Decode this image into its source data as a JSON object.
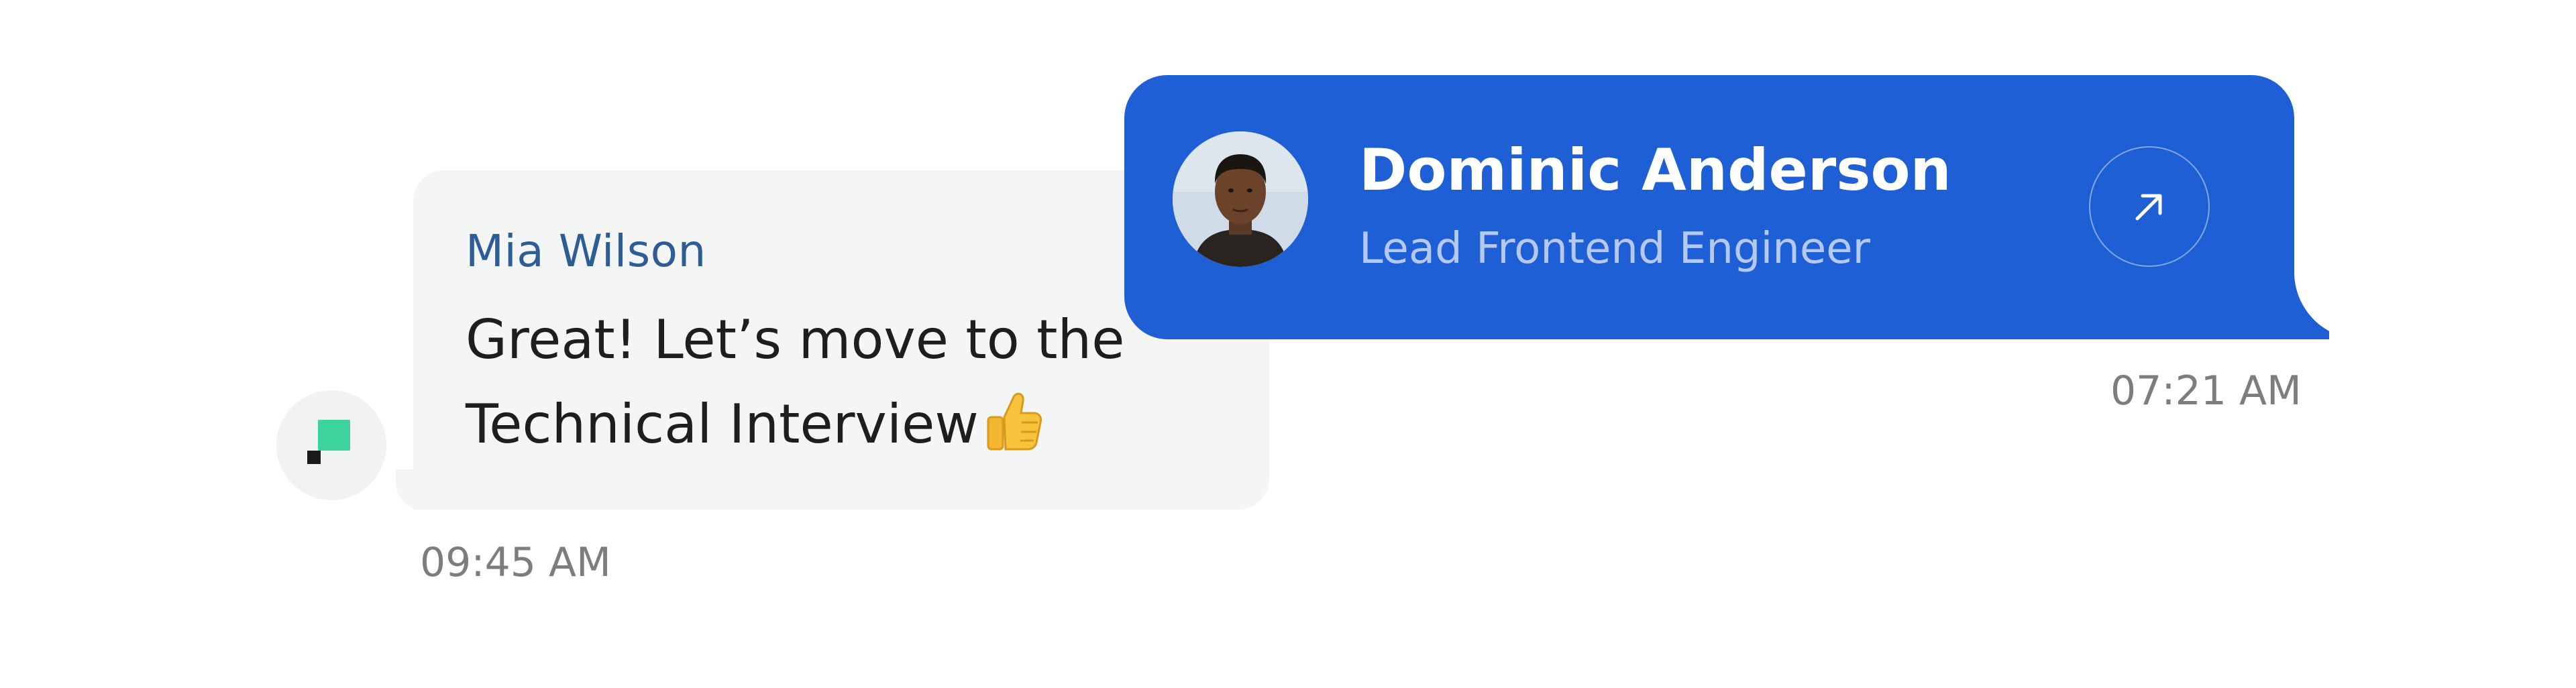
{
  "incoming_message": {
    "sender_name": "Mia Wilson",
    "text_line_1": "Great! Let’s move to the",
    "text_line_2": "Technical Interview",
    "emoji": "thumbs-up-icon",
    "timestamp": "09:45 AM",
    "avatar": "company-logo-icon",
    "bubble_color": "#f4f5f5",
    "name_color": "#2e5d95"
  },
  "contact_card": {
    "name": "Dominic Anderson",
    "role": "Lead Frontend Engineer",
    "timestamp": "07:21 AM",
    "open_icon": "arrow-up-right-icon",
    "card_color": "#1f5fd6"
  }
}
